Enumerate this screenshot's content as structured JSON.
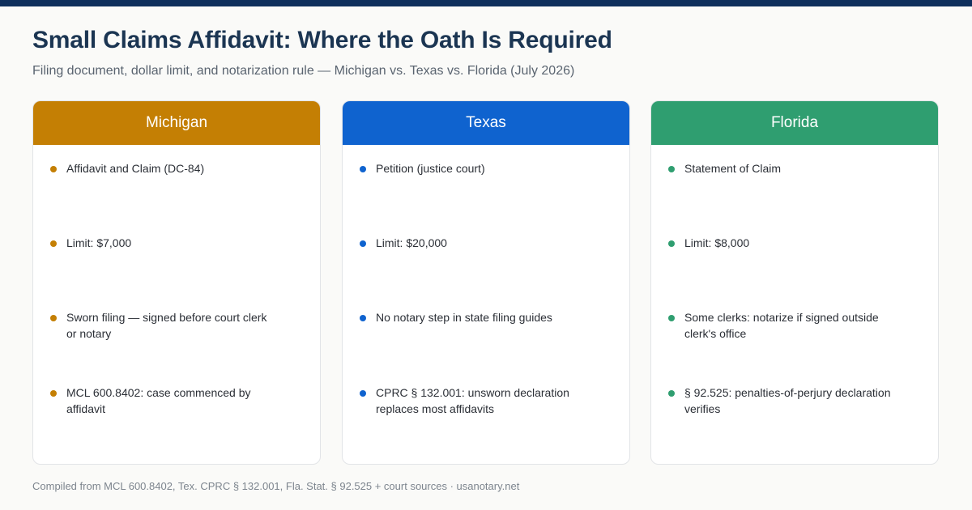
{
  "colors": {
    "top_bar": "#0f2f5c",
    "michigan": "#c47f04",
    "texas": "#0f63cf",
    "florida": "#2f9e70"
  },
  "header": {
    "title": "Small Claims Affidavit: Where the Oath Is Required",
    "subtitle": "Filing document, dollar limit, and notarization rule — Michigan vs. Texas vs. Florida (July 2026)"
  },
  "cards": [
    {
      "state": "Michigan",
      "color": "#c47f04",
      "items": [
        "Affidavit and Claim (DC-84)",
        "Limit: $7,000",
        "Sworn filing — signed before court clerk or notary",
        "MCL 600.8402: case commenced by affidavit"
      ]
    },
    {
      "state": "Texas",
      "color": "#0f63cf",
      "items": [
        "Petition (justice court)",
        "Limit: $20,000",
        "No notary step in state filing guides",
        "CPRC § 132.001: unsworn declaration replaces most affidavits"
      ]
    },
    {
      "state": "Florida",
      "color": "#2f9e70",
      "items": [
        "Statement of Claim",
        "Limit: $8,000",
        "Some clerks: notarize if signed outside clerk's office",
        "§ 92.525: penalties-of-perjury declaration verifies"
      ]
    }
  ],
  "footer": {
    "source": "Compiled from MCL 600.8402, Tex. CPRC § 132.001, Fla. Stat. § 92.525 + court sources · usanotary.net"
  }
}
